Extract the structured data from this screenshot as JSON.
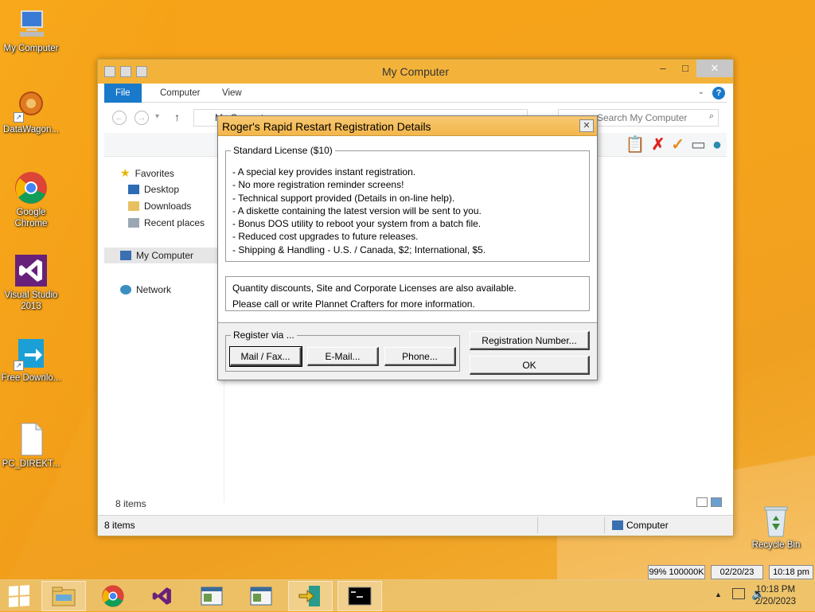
{
  "desktop": {
    "icons": [
      {
        "label": "My Computer"
      },
      {
        "label": "DataWagon..."
      },
      {
        "label": "Google Chrome"
      },
      {
        "label": "Visual Studio 2013"
      },
      {
        "label": "Free Downlo..."
      },
      {
        "label": "PC_DIREKT..."
      },
      {
        "label": "Recycle Bin"
      }
    ]
  },
  "explorer": {
    "title": "My Computer",
    "ribbon": {
      "file": "File",
      "computer": "Computer",
      "view": "View"
    },
    "address": "My Computer",
    "search_placeholder": "Search My Computer",
    "nav": {
      "favorites": "Favorites",
      "desktop": "Desktop",
      "downloads": "Downloads",
      "recent": "Recent places",
      "my_computer": "My Computer",
      "network": "Network"
    },
    "item_count_inner": "8 items",
    "status_left": "8 items",
    "status_right": "Computer"
  },
  "dialog": {
    "title": "Roger's Rapid Restart Registration Details",
    "close_glyph": "✕",
    "standard_license_title": "Standard License ($10)",
    "standard_license_lines": [
      "- A special key provides instant registration.",
      "- No more registration reminder screens!",
      "- Technical support provided (Details in on-line help).",
      "- A diskette containing the latest version will be sent to you.",
      "- Bonus DOS utility to reboot your system from a batch file.",
      "- Reduced cost upgrades to future releases.",
      "- Shipping & Handling - U.S. / Canada, $2;  International, $5."
    ],
    "quantity_lines": [
      "Quantity discounts, Site and Corporate Licenses are also available.",
      "Please call or write Plannet Crafters for more information."
    ],
    "register_via": "Register via ...",
    "buttons": {
      "mail_fax": "Mail / Fax...",
      "email": "E-Mail...",
      "phone": "Phone...",
      "registration_number": "Registration Number...",
      "ok": "OK"
    }
  },
  "status_boxes": {
    "memory": "99% 100000K",
    "date": "02/20/23",
    "time": "10:18 pm"
  },
  "taskbar": {
    "clock_time": "10:18 PM",
    "clock_date": "2/20/2023"
  },
  "colors": {
    "accent": "#1979ca",
    "wallpaper": "#f4a31c",
    "title_bar": "#f3b33b"
  }
}
